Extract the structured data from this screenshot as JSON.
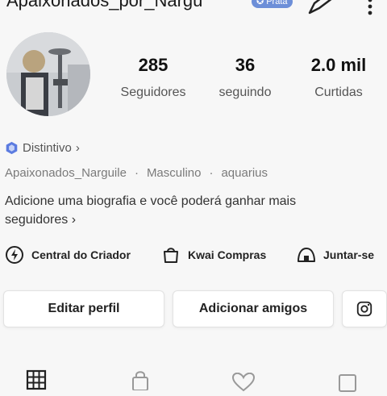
{
  "header": {
    "username": "Apaixonados_por_Nargu",
    "badge_label": "Prata",
    "edit_icon": "pen-icon",
    "more_icon": "more-vertical-icon"
  },
  "profile": {
    "avatar_icon": "profile-photo",
    "stats": [
      {
        "value": "285",
        "label": "Seguidores"
      },
      {
        "value": "36",
        "label": "seguindo"
      },
      {
        "value": "2.0 mil",
        "label": "Curtidas"
      }
    ],
    "distintivo": "Distintivo",
    "meta": {
      "name": "Apaixonados_Narguile",
      "gender": "Masculino",
      "sign": "aquarius"
    },
    "bio_line1": "Adicione uma biografia e você poderá ganhar mais",
    "bio_line2": "seguidores"
  },
  "shortcuts": [
    {
      "label": "Central do Criador",
      "icon": "creator-bolt-icon"
    },
    {
      "label": "Kwai Compras",
      "icon": "shopping-bag-icon"
    },
    {
      "label": "Juntar-se",
      "icon": "join-icon"
    }
  ],
  "actions": {
    "edit_profile": "Editar perfil",
    "add_friends": "Adicionar amigos",
    "instagram_icon": "instagram-icon"
  },
  "tabs": [
    "grid-icon",
    "lock-icon",
    "heart-icon",
    "square-icon"
  ],
  "colors": {
    "background": "#f7f7f7",
    "badge": "#6d8fd8",
    "distintivo_icon": "#5b7be0"
  }
}
